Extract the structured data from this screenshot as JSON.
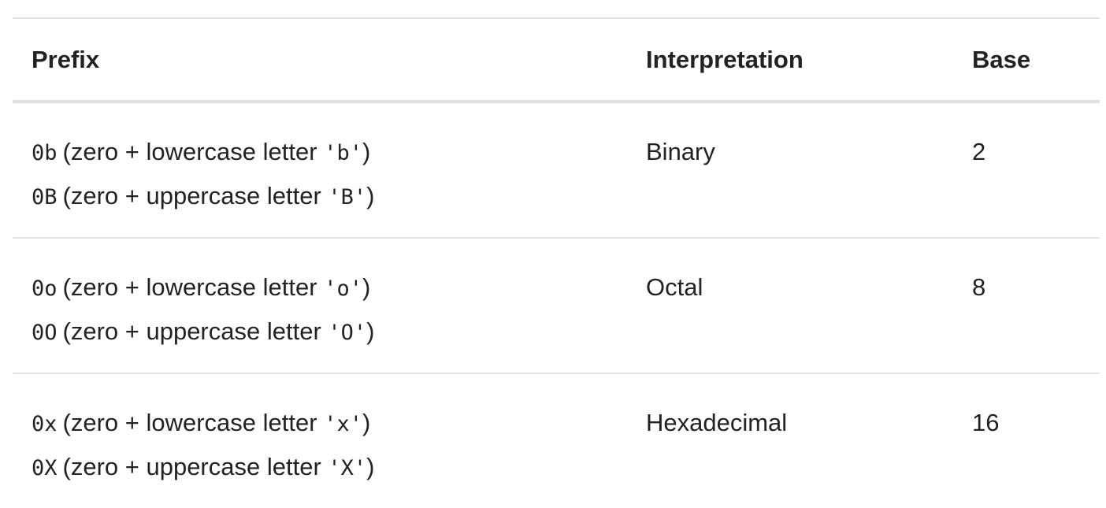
{
  "table": {
    "headers": {
      "prefix": "Prefix",
      "interpretation": "Interpretation",
      "base": "Base"
    },
    "rows": [
      {
        "prefix_lines": [
          {
            "code": "0b",
            "desc": "(zero + lowercase letter ",
            "quoted": "'b'",
            "close": ")"
          },
          {
            "code": "0B",
            "desc": "(zero + uppercase letter ",
            "quoted": "'B'",
            "close": ")"
          }
        ],
        "interpretation": "Binary",
        "base": "2"
      },
      {
        "prefix_lines": [
          {
            "code": "0o",
            "desc": "(zero + lowercase letter ",
            "quoted": "'o'",
            "close": ")"
          },
          {
            "code": "0O",
            "desc": "(zero + uppercase letter ",
            "quoted": "'O'",
            "close": ")"
          }
        ],
        "interpretation": "Octal",
        "base": "8"
      },
      {
        "prefix_lines": [
          {
            "code": "0x",
            "desc": "(zero + lowercase letter ",
            "quoted": "'x'",
            "close": ")"
          },
          {
            "code": "0X",
            "desc": "(zero + uppercase letter ",
            "quoted": "'X'",
            "close": ")"
          }
        ],
        "interpretation": "Hexadecimal",
        "base": "16"
      }
    ]
  }
}
